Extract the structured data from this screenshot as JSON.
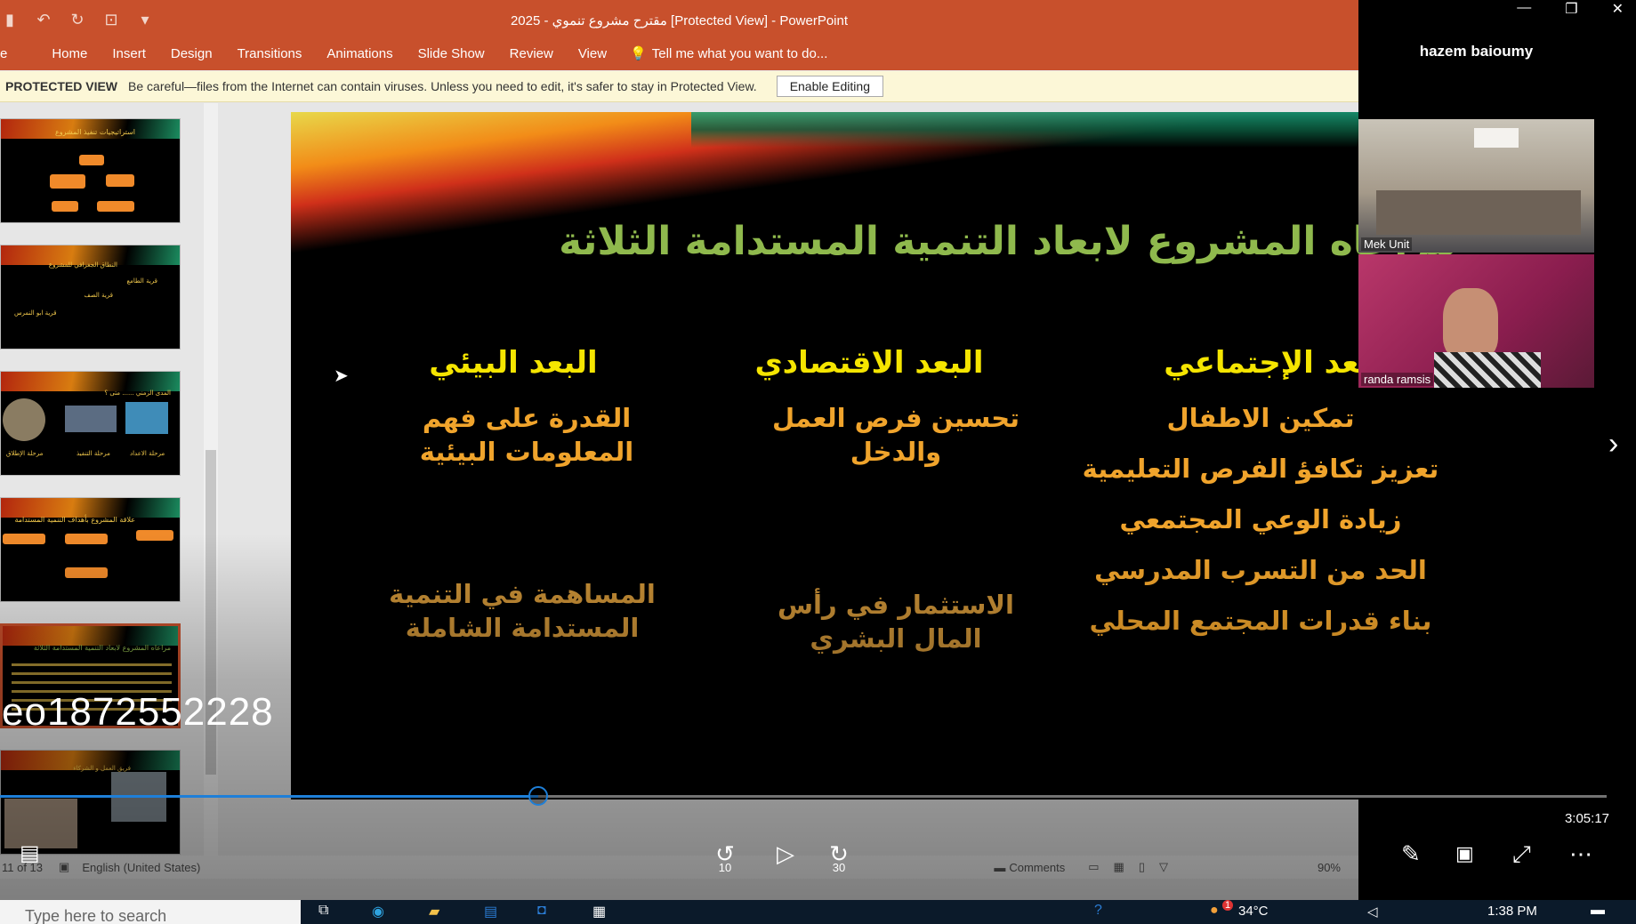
{
  "ppt": {
    "window_title": "2025 - مقترح مشروع تنموي [Protected View] - PowerPoint",
    "qat_icons": [
      "save-icon",
      "undo-icon",
      "redo-icon",
      "slideshow-icon",
      "customize-icon"
    ],
    "ribbon_tabs": [
      "e",
      "Home",
      "Insert",
      "Design",
      "Transitions",
      "Animations",
      "Slide Show",
      "Review",
      "View"
    ],
    "tell_me": "Tell me what you want to do...",
    "protected_label": "PROTECTED VIEW",
    "protected_message": "Be careful—files from the Internet can contain viruses. Unless you need to edit, it's safer to stay in Protected View.",
    "enable_button": "Enable Editing"
  },
  "thumbnails": [
    {
      "title": "استراتيجيات تنفيذ المشروع"
    },
    {
      "title": "النطاق الجغرافي للمشروع",
      "lines": [
        "قرية الطامع",
        "قرية الصف",
        "قرية ابو النمرس"
      ]
    },
    {
      "title": "المدى الزمني ...... متى ؟",
      "lines": [
        "مرحلة الإطلاق",
        "مرحلة التنفيذ",
        "مرحلة الاعداد"
      ]
    },
    {
      "title": "علاقة المشروع بأهداف التنمية المستدامة"
    },
    {
      "title": "مراعاه المشروع لابعاد التنمية المستدامة الثلاثة"
    },
    {
      "title": "فريق العمل و الشركاء"
    }
  ],
  "slide": {
    "title": "مراعاه المشروع لابعاد التنمية المستدامة الثلاثة",
    "col_social": {
      "heading": "البعد الإجتماعي",
      "items": [
        "تمكين الاطفال",
        "تعزيز تكافؤ الفرص التعليمية",
        "زيادة الوعي المجتمعي",
        "الحد من التسرب المدرسي",
        "بناء قدرات المجتمع المحلي"
      ]
    },
    "col_economic": {
      "heading": "البعد الاقتصادي",
      "items": [
        "تحسين فرص العمل والدخل",
        "الاستثمار في رأس المال البشري"
      ]
    },
    "col_environment": {
      "heading": "البعد البيئي",
      "items": [
        "القدرة على فهم المعلومات البيئية",
        "المساهمة في التنمية المستدامة الشاملة"
      ]
    }
  },
  "statusbar": {
    "slide_counter": "11 of 13",
    "language": "English (United States)",
    "comments": "Comments",
    "zoom": "90%"
  },
  "video": {
    "meeting_id": "eo1872552228",
    "duration": "3:05:17",
    "progress_fraction": 0.335,
    "skip_back": "10",
    "skip_forward": "30"
  },
  "participants": {
    "host_name": "hazem baioumy",
    "tiles": [
      {
        "name": "Mek Unit"
      },
      {
        "name": "randa ramsis"
      }
    ]
  },
  "taskbar": {
    "search_placeholder": "Type here to search",
    "temperature": "34°C",
    "time": "1:38 PM",
    "notification_count": "1"
  }
}
